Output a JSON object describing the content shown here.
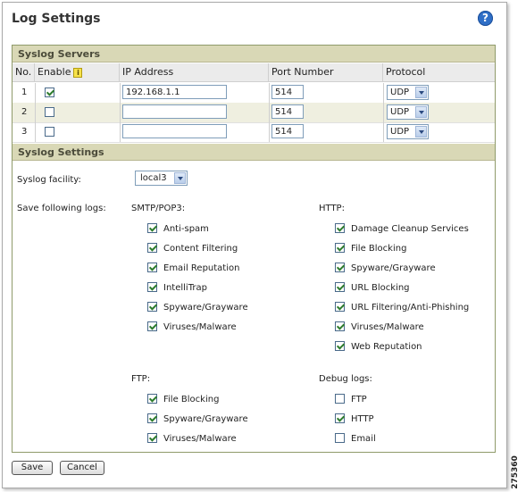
{
  "title": "Log Settings",
  "help_icon": "help-icon",
  "syslog_servers": {
    "heading": "Syslog Servers",
    "columns": [
      "No.",
      "Enable",
      "IP Address",
      "Port Number",
      "Protocol"
    ],
    "rows": [
      {
        "no": "1",
        "enabled": true,
        "ip": "192.168.1.1",
        "port": "514",
        "protocol": "UDP"
      },
      {
        "no": "2",
        "enabled": false,
        "ip": "",
        "port": "514",
        "protocol": "UDP"
      },
      {
        "no": "3",
        "enabled": false,
        "ip": "",
        "port": "514",
        "protocol": "UDP"
      }
    ]
  },
  "syslog_settings": {
    "heading": "Syslog Settings",
    "facility_label": "Syslog facility:",
    "facility_value": "local3",
    "save_logs_label": "Save following logs:",
    "smtp": {
      "label": "SMTP/POP3:",
      "items": [
        {
          "label": "Anti-spam",
          "checked": true
        },
        {
          "label": "Content Filtering",
          "checked": true
        },
        {
          "label": "Email Reputation",
          "checked": true
        },
        {
          "label": "IntelliTrap",
          "checked": true
        },
        {
          "label": "Spyware/Grayware",
          "checked": true
        },
        {
          "label": "Viruses/Malware",
          "checked": true
        }
      ]
    },
    "http": {
      "label": "HTTP:",
      "items": [
        {
          "label": "Damage Cleanup Services",
          "checked": true
        },
        {
          "label": "File Blocking",
          "checked": true
        },
        {
          "label": "Spyware/Grayware",
          "checked": true
        },
        {
          "label": "URL Blocking",
          "checked": true
        },
        {
          "label": "URL Filtering/Anti-Phishing",
          "checked": true
        },
        {
          "label": "Viruses/Malware",
          "checked": true
        },
        {
          "label": "Web Reputation",
          "checked": true
        }
      ]
    },
    "ftp": {
      "label": "FTP:",
      "items": [
        {
          "label": "File Blocking",
          "checked": true
        },
        {
          "label": "Spyware/Grayware",
          "checked": true
        },
        {
          "label": "Viruses/Malware",
          "checked": true
        }
      ]
    },
    "debug": {
      "label": "Debug logs:",
      "items": [
        {
          "label": "FTP",
          "checked": false
        },
        {
          "label": "HTTP",
          "checked": true
        },
        {
          "label": "Email",
          "checked": false
        }
      ]
    }
  },
  "buttons": {
    "save": "Save",
    "cancel": "Cancel"
  },
  "figure_code": "275360"
}
